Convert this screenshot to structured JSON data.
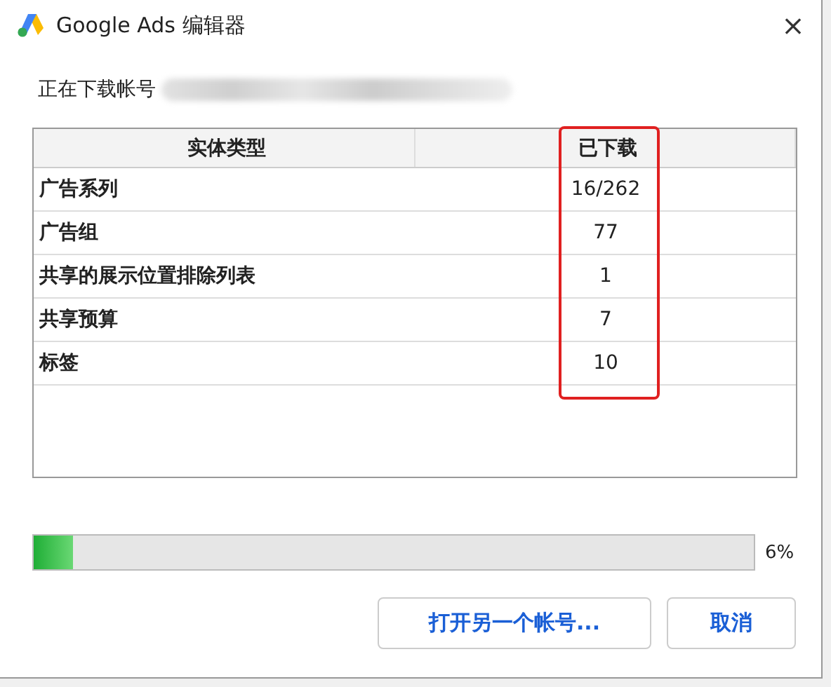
{
  "window": {
    "title": "Google Ads 编辑器",
    "close": "×"
  },
  "status_text": "正在下载帐号",
  "table": {
    "columns": [
      {
        "label": "实体类型",
        "highlighted": false
      },
      {
        "label": "已下载",
        "highlighted": true
      }
    ],
    "rows": [
      [
        "广告系列",
        "16/262"
      ],
      [
        "广告组",
        "77"
      ],
      [
        "共享的展示位置排除列表",
        "1"
      ],
      [
        "共享预算",
        "7"
      ],
      [
        "标签",
        "10"
      ]
    ]
  },
  "progress": {
    "level": 0.055,
    "reading": "6%"
  },
  "buttons": [
    "打开另一个帐号...",
    "取消"
  ]
}
